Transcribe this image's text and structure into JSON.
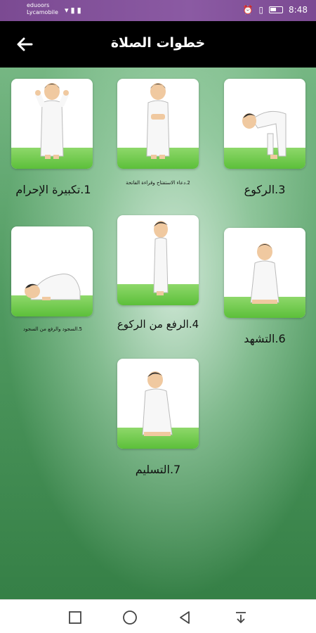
{
  "status_bar": {
    "carrier_line1": "eduoors",
    "carrier_line2": "Lycamobile",
    "time": "8:48"
  },
  "app_bar": {
    "title": "خطوات الصلاة",
    "back_icon": "arrow-left-icon"
  },
  "steps": [
    {
      "label": "1.تكبيرة الإحرام",
      "icon": "takbir-illustration"
    },
    {
      "label": "2.دعاء الاستفتاح وقراءة الفاتحة",
      "icon": "standing-recitation-illustration"
    },
    {
      "label": "3.الركوع",
      "icon": "ruku-illustration"
    },
    {
      "label": "4.الرفع من الركوع",
      "icon": "rising-illustration"
    },
    {
      "label": "5.السجود والرفع من السجود",
      "icon": "sujud-illustration"
    },
    {
      "label": "6.التشهد",
      "icon": "tashahhud-illustration"
    },
    {
      "label": "7.التسليم",
      "icon": "taslim-illustration"
    }
  ],
  "nav_bar": {
    "icons": [
      "square-icon",
      "circle-icon",
      "triangle-back-icon",
      "download-arrow-icon"
    ]
  }
}
